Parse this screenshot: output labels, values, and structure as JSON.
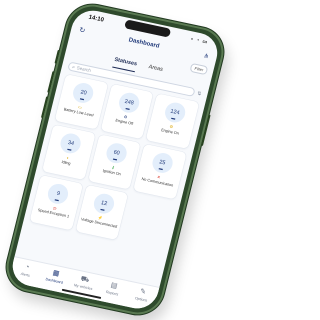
{
  "status_bar": {
    "time": "14:10",
    "icons": "▪ ◔ ▭"
  },
  "header": {
    "title": "Dashboard",
    "left_icon": "↻",
    "right_icon": "⋔"
  },
  "toolbar": {
    "filter_label": "Filter"
  },
  "tabs": [
    {
      "label": "Statuses",
      "active": true
    },
    {
      "label": "Areas",
      "active": false
    }
  ],
  "search": {
    "placeholder": "Search",
    "sort_icon": "⇅"
  },
  "cards": [
    {
      "count": "20",
      "label": "Battery Low Level",
      "mini_icon": "▭",
      "icon_color": "#d9a300"
    },
    {
      "count": "248",
      "label": "Engine Off",
      "mini_icon": "⚙",
      "icon_color": "#213a7a"
    },
    {
      "count": "124",
      "label": "Engine On",
      "mini_icon": "⚙",
      "icon_color": "#d9a300"
    },
    {
      "count": "34",
      "label": "Idling",
      "mini_icon": "◑",
      "icon_color": "#d9a300"
    },
    {
      "count": "60",
      "label": "Ignition On",
      "mini_icon": "⚷",
      "icon_color": "#2a9d3a"
    },
    {
      "count": "25",
      "label": "No Communication",
      "mini_icon": "✕",
      "icon_color": "#d93025"
    },
    {
      "count": "9",
      "label": "Speed Exception 1",
      "mini_icon": "◷",
      "icon_color": "#d93025"
    },
    {
      "count": "12",
      "label": "Voltage Disconnected",
      "mini_icon": "⚡",
      "icon_color": "#d93025"
    }
  ],
  "bottom_nav": [
    {
      "label": "Alerts",
      "icon": "◔",
      "active": false
    },
    {
      "label": "Dashboard",
      "icon": "▦",
      "active": true
    },
    {
      "label": "My vehicles",
      "icon": "⛟",
      "active": false
    },
    {
      "label": "Reports",
      "icon": "▤",
      "active": false
    },
    {
      "label": "Options",
      "icon": "✎",
      "active": false
    }
  ]
}
